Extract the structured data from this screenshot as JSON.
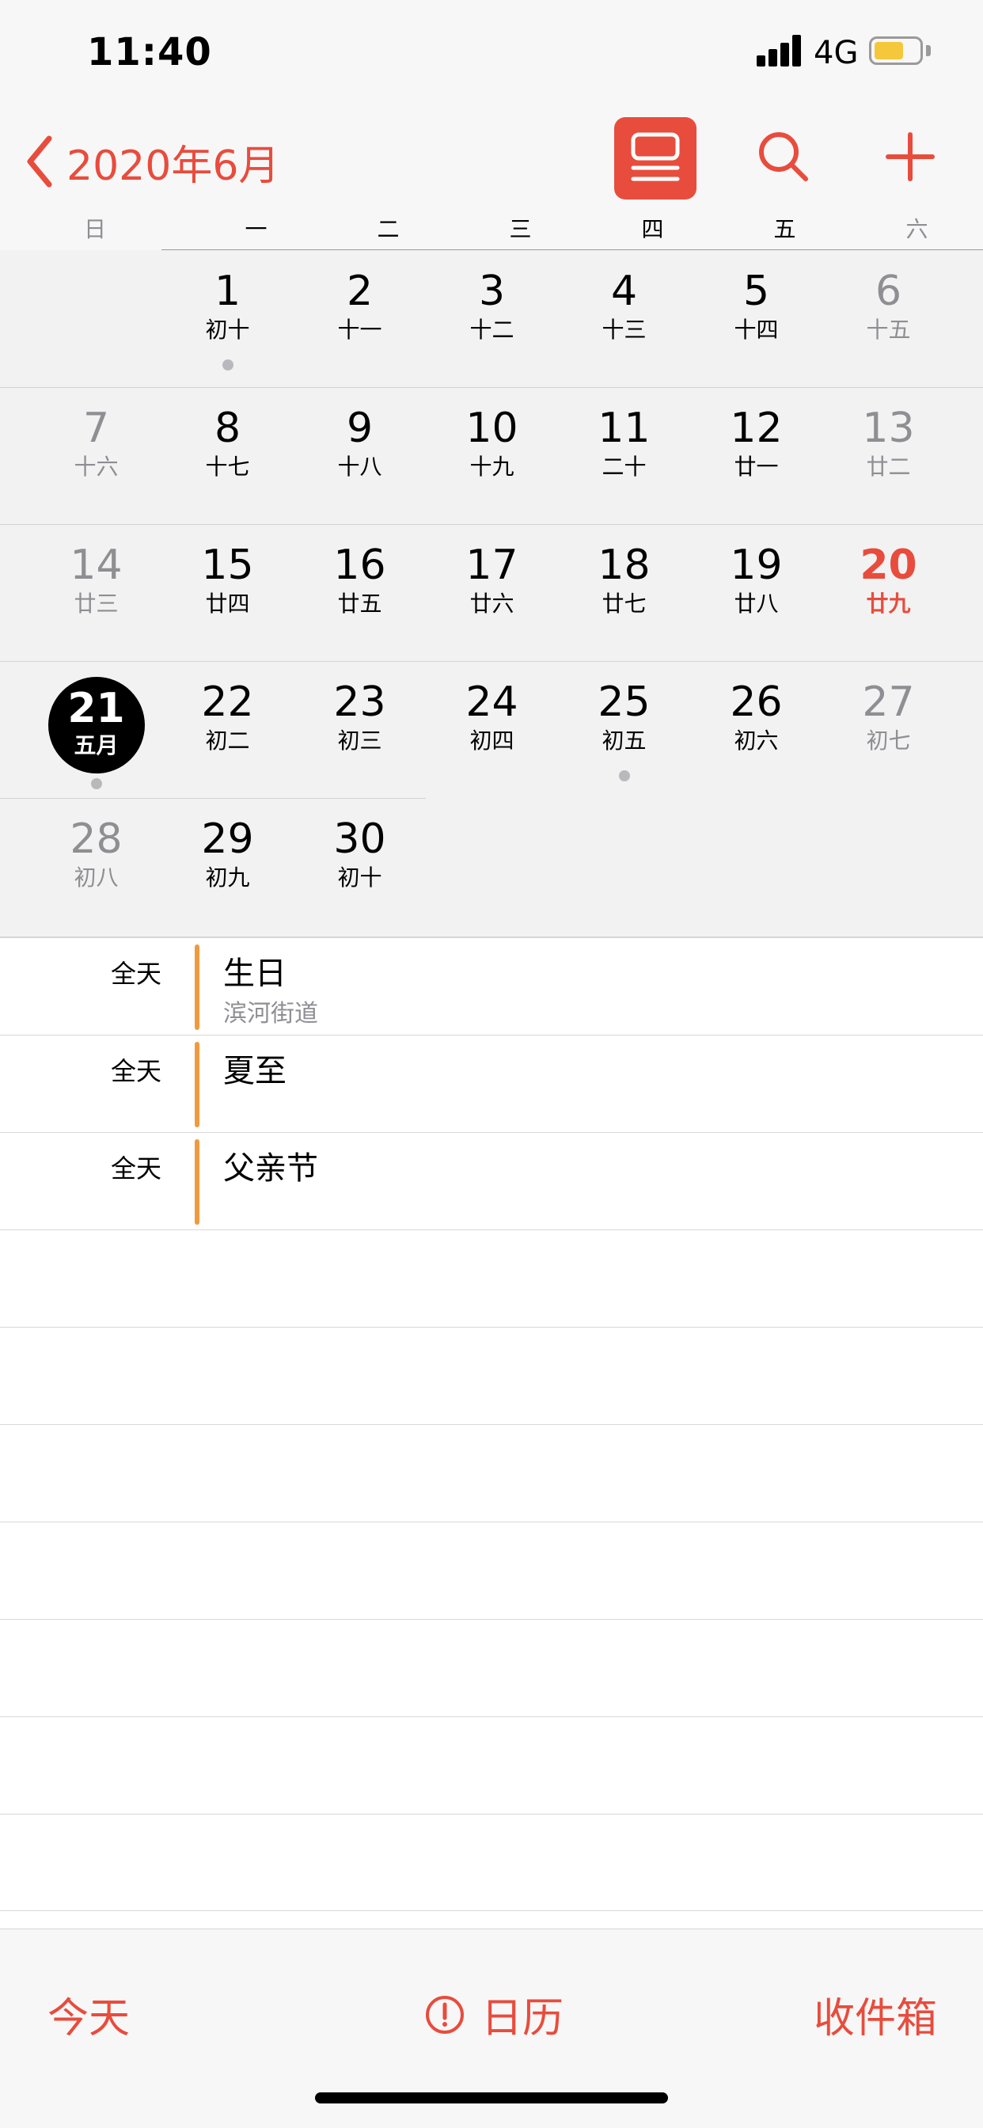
{
  "status_bar": {
    "time": "11:40",
    "network": "4G",
    "battery_level": 0.65
  },
  "nav": {
    "back_icon": "chevron-left-icon",
    "title": "2020年6月",
    "list_icon": "list-view-icon",
    "search_icon": "search-icon",
    "add_icon": "plus-icon",
    "accent_color": "#e84c3d"
  },
  "weekdays": [
    "日",
    "一",
    "二",
    "三",
    "四",
    "五",
    "六"
  ],
  "month": {
    "weeks": [
      [
        null,
        {
          "num": "1",
          "lunar": "初十",
          "dot": true
        },
        {
          "num": "2",
          "lunar": "十一"
        },
        {
          "num": "3",
          "lunar": "十二"
        },
        {
          "num": "4",
          "lunar": "十三"
        },
        {
          "num": "5",
          "lunar": "十四"
        },
        {
          "num": "6",
          "lunar": "十五"
        }
      ],
      [
        {
          "num": "7",
          "lunar": "十六"
        },
        {
          "num": "8",
          "lunar": "十七"
        },
        {
          "num": "9",
          "lunar": "十八"
        },
        {
          "num": "10",
          "lunar": "十九"
        },
        {
          "num": "11",
          "lunar": "二十"
        },
        {
          "num": "12",
          "lunar": "廿一"
        },
        {
          "num": "13",
          "lunar": "廿二"
        }
      ],
      [
        {
          "num": "14",
          "lunar": "廿三"
        },
        {
          "num": "15",
          "lunar": "廿四"
        },
        {
          "num": "16",
          "lunar": "廿五"
        },
        {
          "num": "17",
          "lunar": "廿六"
        },
        {
          "num": "18",
          "lunar": "廿七"
        },
        {
          "num": "19",
          "lunar": "廿八"
        },
        {
          "num": "20",
          "lunar": "廿九",
          "today": true
        }
      ],
      [
        {
          "num": "21",
          "lunar": "五月",
          "selected": true,
          "dot": true
        },
        {
          "num": "22",
          "lunar": "初二"
        },
        {
          "num": "23",
          "lunar": "初三"
        },
        {
          "num": "24",
          "lunar": "初四"
        },
        {
          "num": "25",
          "lunar": "初五",
          "dot": true
        },
        {
          "num": "26",
          "lunar": "初六"
        },
        {
          "num": "27",
          "lunar": "初七"
        }
      ],
      [
        {
          "num": "28",
          "lunar": "初八"
        },
        {
          "num": "29",
          "lunar": "初九"
        },
        {
          "num": "30",
          "lunar": "初十"
        },
        null,
        null,
        null,
        null
      ]
    ]
  },
  "events": [
    {
      "time": "全天",
      "title": "生日",
      "subtitle": "滨河街道"
    },
    {
      "time": "全天",
      "title": "夏至",
      "subtitle": ""
    },
    {
      "time": "全天",
      "title": "父亲节",
      "subtitle": ""
    }
  ],
  "event_color": "#f09a3e",
  "tab_bar": {
    "today": "今天",
    "calendars": "日历",
    "calendars_icon": "alert-circle-icon",
    "inbox": "收件箱"
  }
}
